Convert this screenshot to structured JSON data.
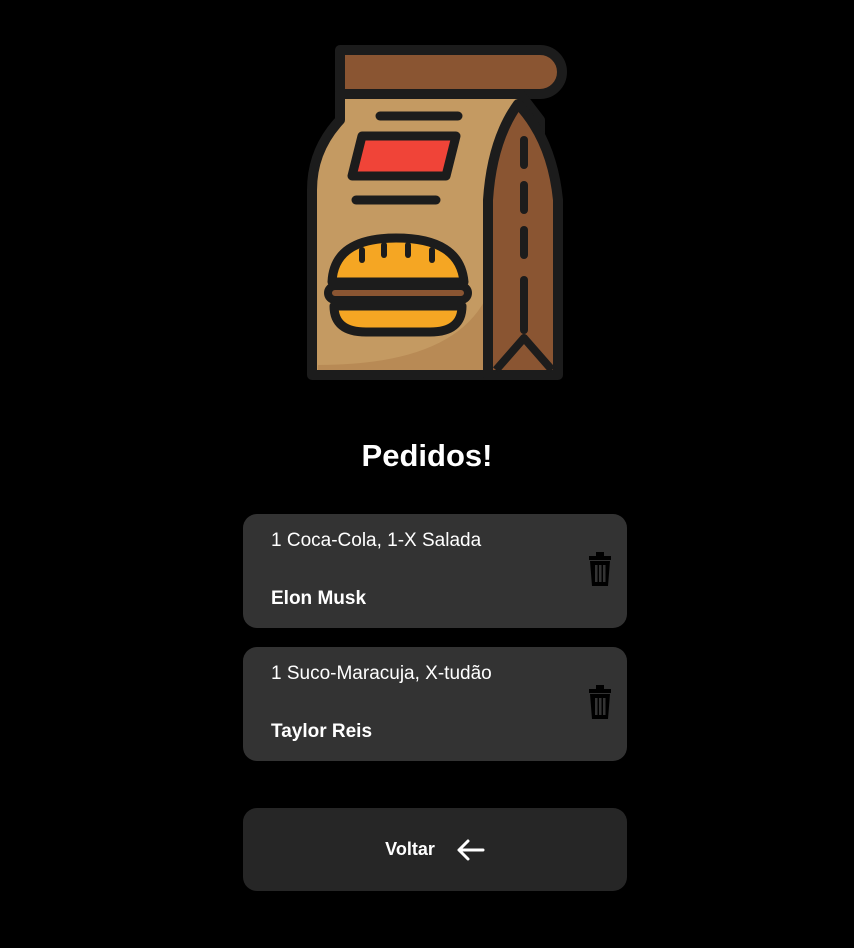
{
  "header": {
    "logo_icon": "food-bag-burger-icon",
    "title": "Pedidos!"
  },
  "orders": [
    {
      "items": "1 Coca-Cola, 1-X Salada",
      "customer": "Elon Musk",
      "action_icon": "trash-icon"
    },
    {
      "items": "1 Suco-Maracuja, X-tudão",
      "customer": "Taylor Reis",
      "action_icon": "trash-icon"
    }
  ],
  "back_button": {
    "label": "Voltar",
    "icon": "arrow-left-icon"
  },
  "colors": {
    "background": "#000000",
    "card": "#333333",
    "button": "#262626",
    "text": "#ffffff"
  }
}
